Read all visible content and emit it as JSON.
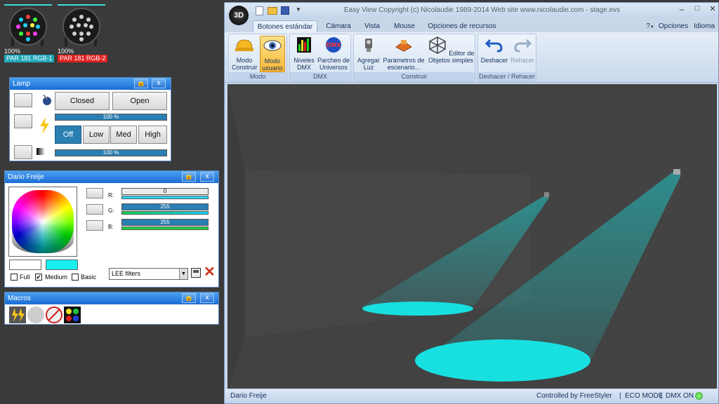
{
  "fixtures": [
    {
      "percent": "100%",
      "name": "PAR 181 RGB-1",
      "color": "#1fa8b8"
    },
    {
      "percent": "100%",
      "name": "PAR 181 RGB-2",
      "color": "#e02020"
    }
  ],
  "lamp_panel": {
    "title": "Lamp",
    "lock_icon": "lock-icon",
    "close_label": "x",
    "closed_label": "Closed",
    "open_label": "Open",
    "dimmer_value": "100 %",
    "dimmer_level": 1.0,
    "strobe_buttons": [
      "Off",
      "Low",
      "Med",
      "High"
    ],
    "strobe_selected": "Off",
    "shutter_value": "100 %",
    "shutter_level": 1.0
  },
  "color_panel": {
    "title": "Dario Freije",
    "close_label": "x",
    "r_label": "R:",
    "g_label": "G:",
    "b_label": "B:",
    "r_value": "0",
    "g_value": "255",
    "b_value": "255",
    "r_level": 0,
    "g_level": 1,
    "b_level": 1,
    "preview_color": "#18f0f0",
    "palette_full": "Full",
    "palette_medium": "Medium",
    "palette_basic": "Basic",
    "palette_medium_checked": true,
    "filter_select": "LEE filters"
  },
  "macros_panel": {
    "title": "Macros",
    "close_label": "x"
  },
  "window": {
    "title": "Easy View   Copyright (c) Nicolaudie 1989-2014   Web site www.nicolaudie.com - stage.evs",
    "logo": "3D",
    "tabs": [
      "Botones estándar",
      "Cámara",
      "Vista",
      "Mouse",
      "Opciones de recursos"
    ],
    "active_tab": "Botones estándar",
    "help": "?",
    "options": "Opciones",
    "language": "Idioma",
    "groups": {
      "modo": "Modo",
      "dmx": "DMX",
      "construir": "Construir",
      "undo": "Deshacer / Rehacer"
    },
    "buttons": {
      "modo_construir": "Modo Construir",
      "modo_usuario": "Modo usuario",
      "niveles_dmx": "Niveles DMX",
      "parcheo": "Parcheo de Universos",
      "agregar_luz": "Agregar Luz",
      "parametros": "Parámetros de escenario...",
      "editor": "Editor de Objetos simples",
      "deshacer": "Deshacer",
      "rehacer": "Rehacer"
    },
    "status_left": "Dario Freije",
    "status_controlled": "Controlled by FreeStyler",
    "status_eco": "ECO MODE",
    "status_dmx": "DMX ON"
  },
  "colors": {
    "beam": "#18e0e0",
    "accent": "#2a7fb3"
  }
}
